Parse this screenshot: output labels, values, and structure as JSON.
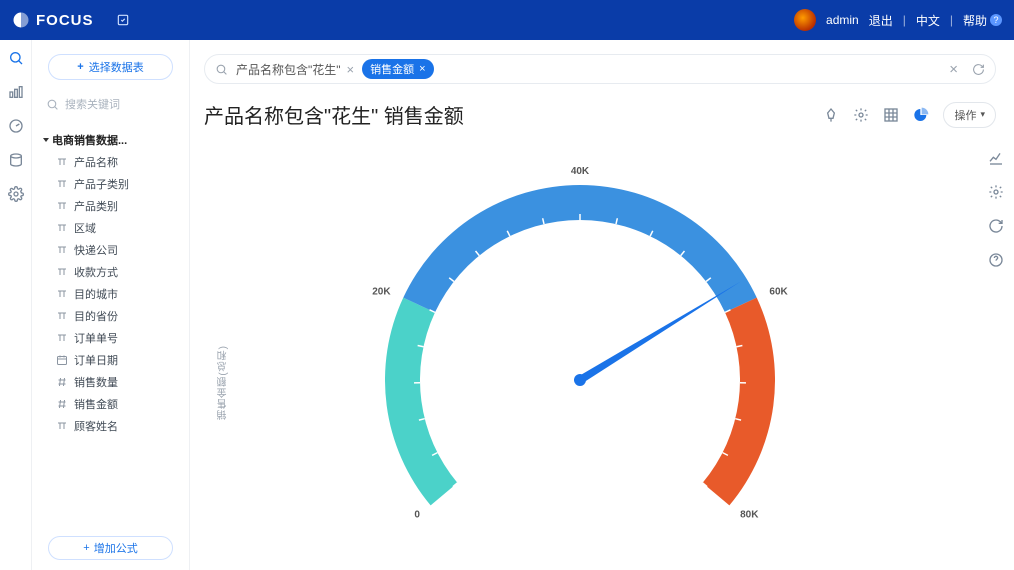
{
  "header": {
    "brand": "FOCUS",
    "user": "admin",
    "logout": "退出",
    "lang": "中文",
    "help": "帮助"
  },
  "sidebar": {
    "select_button": "选择数据表",
    "search_placeholder": "搜索关键词",
    "group": "电商销售数据...",
    "fields": [
      "产品名称",
      "产品子类别",
      "产品类别",
      "区域",
      "快递公司",
      "收款方式",
      "目的城市",
      "目的省份",
      "订单单号",
      "订单日期",
      "销售数量",
      "销售金额",
      "顾客姓名"
    ],
    "add_formula": "增加公式"
  },
  "query": {
    "text": "产品名称包含\"花生\"",
    "tag": "销售金额"
  },
  "title": "产品名称包含\"花生\"  销售金额",
  "ops_label": "操作",
  "axis_label": "销售金额(总和)",
  "chart_data": {
    "type": "gauge",
    "min": 0,
    "max": 80000,
    "value": 58000,
    "ticks": [
      {
        "v": 0,
        "label": "0"
      },
      {
        "v": 20000,
        "label": "20K"
      },
      {
        "v": 40000,
        "label": "40K"
      },
      {
        "v": 60000,
        "label": "60K"
      },
      {
        "v": 80000,
        "label": "80K"
      }
    ],
    "segments": [
      {
        "from": 0,
        "to": 20000,
        "color": "#4bd2c9"
      },
      {
        "from": 20000,
        "to": 60000,
        "color": "#3b91e0"
      },
      {
        "from": 60000,
        "to": 80000,
        "color": "#e85a2a"
      }
    ],
    "ylabel": "销售金额(总和)"
  }
}
